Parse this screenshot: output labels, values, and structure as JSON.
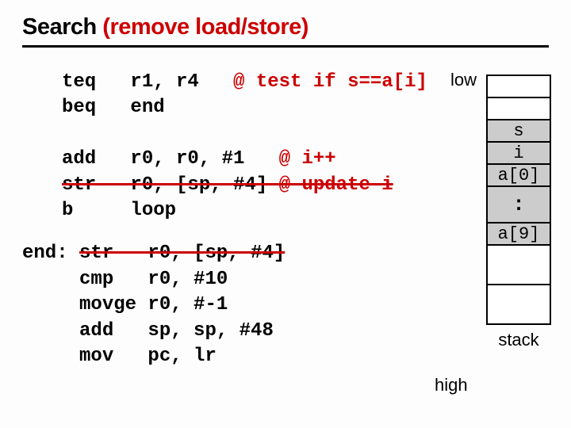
{
  "title": {
    "black": "Search ",
    "red": "(remove load/store)"
  },
  "labels": {
    "low": "low",
    "high": "high",
    "stack": "stack"
  },
  "stack_cells": {
    "empty1": "",
    "empty2": "",
    "s": "s",
    "i": "i",
    "a0": "a[0]",
    "dots": ":",
    "a9": "a[9]"
  },
  "code": {
    "l1a": "teq   r1, r4   ",
    "l1b": "@ test if s==a[i]",
    "l2": "beq   end",
    "l4a": "add   r0, r0, #1   ",
    "l4b": "@ i++",
    "l5a": "str   r0, [sp, #4] ",
    "l5b": "@ update i",
    "l6": "b     loop",
    "end_label": "end: ",
    "l8": "str   r0, [sp, #4]",
    "l9": "cmp   r0, #10",
    "l10": "movge r0, #-1",
    "l11": "add   sp, sp, #48",
    "l12": "mov   pc, lr"
  }
}
